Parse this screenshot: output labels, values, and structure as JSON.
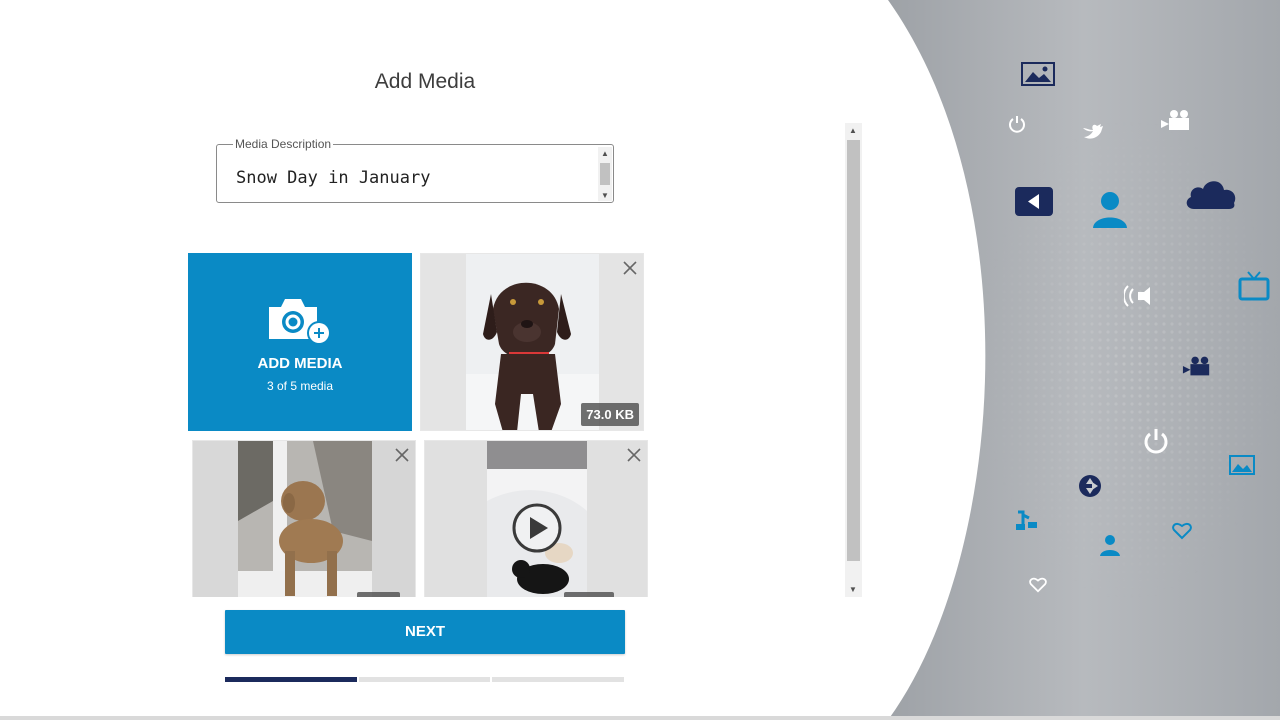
{
  "page": {
    "title": "Add Media"
  },
  "description": {
    "legend": "Media Description",
    "value": "Snow Day in January"
  },
  "add_media": {
    "label": "ADD MEDIA",
    "count": "3 of 5 media"
  },
  "media": [
    {
      "type": "photo",
      "subject": "chocolate labrador in snow",
      "size": "73.0 KB"
    },
    {
      "type": "photo",
      "subject": "poodle in snowy yard",
      "size": ""
    },
    {
      "type": "video",
      "subject": "small dog in snow",
      "size": ""
    }
  ],
  "next_button": {
    "label": "NEXT"
  },
  "progress": {
    "current_step": 1,
    "total_steps": 3
  },
  "colors": {
    "accent": "#0a8ac5",
    "navy": "#1b2a5c",
    "panel_gray": "#a4a8ad"
  },
  "decor_icons": [
    "image-icon",
    "power-icon",
    "twitter-icon",
    "video-camera-icon",
    "play-back-icon",
    "user-icon",
    "cloud-icon",
    "speaker-icon",
    "tv-icon",
    "music-icon",
    "camera-shutter-icon",
    "heart-icon"
  ]
}
